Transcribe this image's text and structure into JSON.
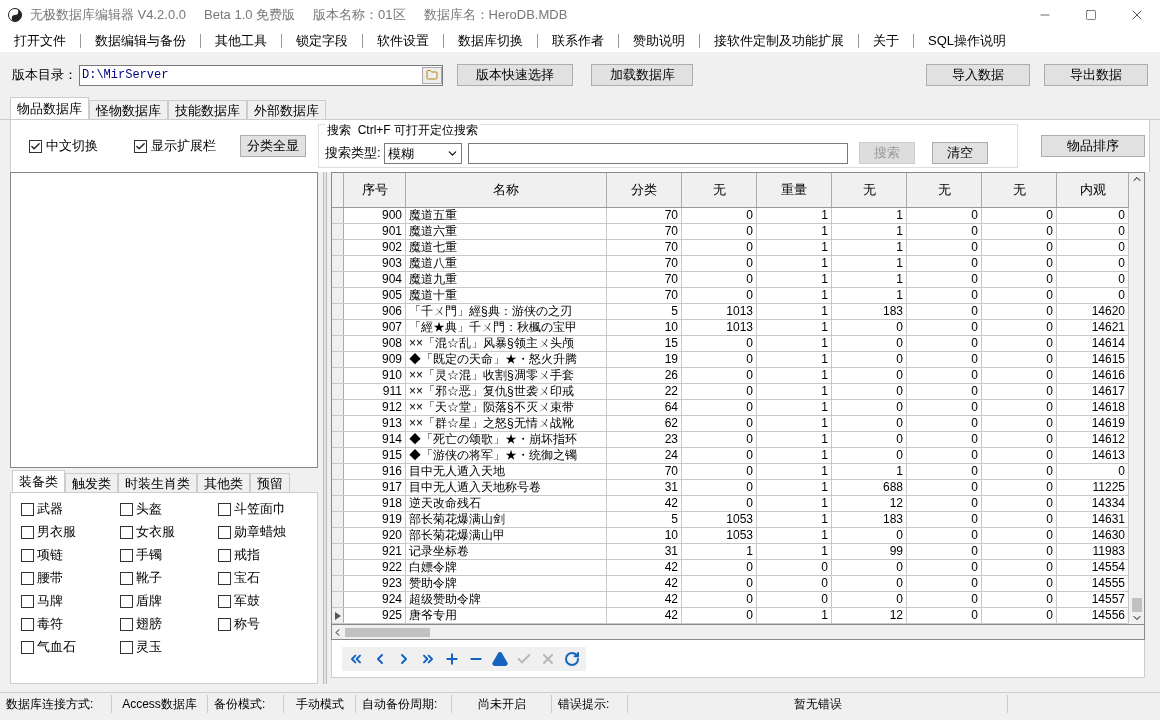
{
  "window": {
    "title_parts": [
      "无极数据库编辑器 V4.2.0.0",
      "Beta 1.0 免费版",
      "版本名称：01区",
      "数据库名：HeroDB.MDB"
    ]
  },
  "menu": [
    "打开文件",
    "数据编辑与备份",
    "其他工具",
    "锁定字段",
    "软件设置",
    "数据库切换",
    "联系作者",
    "赞助说明",
    "接软件定制及功能扩展",
    "关于",
    "SQL操作说明"
  ],
  "toolbar": {
    "path_label": "版本目录：",
    "path_value": "D:\\MirServer",
    "buttons_left": [
      "版本快速选择",
      "加载数据库"
    ],
    "buttons_right": [
      "导入数据",
      "导出数据"
    ]
  },
  "tabs": [
    {
      "label": "物品数据库",
      "selected": true
    },
    {
      "label": "怪物数据库",
      "selected": false
    },
    {
      "label": "技能数据库",
      "selected": false
    },
    {
      "label": "外部数据库",
      "selected": false
    }
  ],
  "options": {
    "checkboxes": [
      {
        "label": "中文切换",
        "checked": true
      },
      {
        "label": "显示扩展栏",
        "checked": true
      }
    ],
    "show_all_button": "分类全显",
    "search_group_title": "搜索  Ctrl+F 可打开定位搜索",
    "search_type_label": "搜索类型:",
    "search_type_value": "模糊",
    "search_button": {
      "label": "搜索",
      "disabled": true
    },
    "clear_button": "清空",
    "sort_button": "物品排序"
  },
  "category_tabs": [
    {
      "label": "装备类",
      "selected": true
    },
    {
      "label": "触发类",
      "selected": false
    },
    {
      "label": "时装生肖类",
      "selected": false
    },
    {
      "label": "其他类",
      "selected": false
    },
    {
      "label": "预留",
      "selected": false
    }
  ],
  "category_items": [
    {
      "label": "武器",
      "checked": false
    },
    {
      "label": "头盔",
      "checked": false
    },
    {
      "label": "斗笠面巾",
      "checked": false
    },
    {
      "label": "男衣服",
      "checked": false
    },
    {
      "label": "女衣服",
      "checked": false
    },
    {
      "label": "勋章蜡烛",
      "checked": false
    },
    {
      "label": "项链",
      "checked": false
    },
    {
      "label": "手镯",
      "checked": false
    },
    {
      "label": "戒指",
      "checked": false
    },
    {
      "label": "腰带",
      "checked": false
    },
    {
      "label": "靴子",
      "checked": false
    },
    {
      "label": "宝石",
      "checked": false
    },
    {
      "label": "马牌",
      "checked": false
    },
    {
      "label": "盾牌",
      "checked": false
    },
    {
      "label": "军鼓",
      "checked": false
    },
    {
      "label": "毒符",
      "checked": false
    },
    {
      "label": "翅膀",
      "checked": false
    },
    {
      "label": "称号",
      "checked": false
    },
    {
      "label": "气血石",
      "checked": false
    },
    {
      "label": "灵玉",
      "checked": false
    }
  ],
  "table": {
    "columns": [
      "序号",
      "名称",
      "分类",
      "无",
      "重量",
      "无",
      "无",
      "无",
      "内观"
    ],
    "rows": [
      {
        "current": false,
        "cells": [
          "900",
          "魔道五重",
          "70",
          "0",
          "1",
          "1",
          "0",
          "0",
          "0"
        ]
      },
      {
        "current": false,
        "cells": [
          "901",
          "魔道六重",
          "70",
          "0",
          "1",
          "1",
          "0",
          "0",
          "0"
        ]
      },
      {
        "current": false,
        "cells": [
          "902",
          "魔道七重",
          "70",
          "0",
          "1",
          "1",
          "0",
          "0",
          "0"
        ]
      },
      {
        "current": false,
        "cells": [
          "903",
          "魔道八重",
          "70",
          "0",
          "1",
          "1",
          "0",
          "0",
          "0"
        ]
      },
      {
        "current": false,
        "cells": [
          "904",
          "魔道九重",
          "70",
          "0",
          "1",
          "1",
          "0",
          "0",
          "0"
        ]
      },
      {
        "current": false,
        "cells": [
          "905",
          "魔道十重",
          "70",
          "0",
          "1",
          "1",
          "0",
          "0",
          "0"
        ]
      },
      {
        "current": false,
        "cells": [
          "906",
          "「千ㄨ門」經§典：游侠の之刃",
          "5",
          "1013",
          "1",
          "183",
          "0",
          "0",
          "14620"
        ]
      },
      {
        "current": false,
        "cells": [
          "907",
          "「經★典」千ㄨ門：秋楓の宝甲",
          "10",
          "1013",
          "1",
          "0",
          "0",
          "0",
          "14621"
        ]
      },
      {
        "current": false,
        "cells": [
          "908",
          "××「混☆乱」风暴§领主ㄨ头颅",
          "15",
          "0",
          "1",
          "0",
          "0",
          "0",
          "14614"
        ]
      },
      {
        "current": false,
        "cells": [
          "909",
          "◆「既定の天命」★・怒火升腾",
          "19",
          "0",
          "1",
          "0",
          "0",
          "0",
          "14615"
        ]
      },
      {
        "current": false,
        "cells": [
          "910",
          "××「灵☆混」收割§凋零ㄨ手套",
          "26",
          "0",
          "1",
          "0",
          "0",
          "0",
          "14616"
        ]
      },
      {
        "current": false,
        "cells": [
          "911",
          "××「邪☆恶」复仇§世袭ㄨ印戒",
          "22",
          "0",
          "1",
          "0",
          "0",
          "0",
          "14617"
        ]
      },
      {
        "current": false,
        "cells": [
          "912",
          "××「天☆堂」陨落§不灭ㄨ束带",
          "64",
          "0",
          "1",
          "0",
          "0",
          "0",
          "14618"
        ]
      },
      {
        "current": false,
        "cells": [
          "913",
          "××「群☆星」之怒§无情ㄨ战靴",
          "62",
          "0",
          "1",
          "0",
          "0",
          "0",
          "14619"
        ]
      },
      {
        "current": false,
        "cells": [
          "914",
          "◆「死亡の颂歌」★・崩坏指环",
          "23",
          "0",
          "1",
          "0",
          "0",
          "0",
          "14612"
        ]
      },
      {
        "current": false,
        "cells": [
          "915",
          "◆「游侠の将军」★・统御之镯",
          "24",
          "0",
          "1",
          "0",
          "0",
          "0",
          "14613"
        ]
      },
      {
        "current": false,
        "cells": [
          "916",
          "目中无人遁入天地",
          "70",
          "0",
          "1",
          "1",
          "0",
          "0",
          "0"
        ]
      },
      {
        "current": false,
        "cells": [
          "917",
          "目中无人遁入天地称号卷",
          "31",
          "0",
          "1",
          "688",
          "0",
          "0",
          "11225"
        ]
      },
      {
        "current": false,
        "cells": [
          "918",
          "逆天改命残石",
          "42",
          "0",
          "1",
          "12",
          "0",
          "0",
          "14334"
        ]
      },
      {
        "current": false,
        "cells": [
          "919",
          "部长菊花爆满山剑",
          "5",
          "1053",
          "1",
          "183",
          "0",
          "0",
          "14631"
        ]
      },
      {
        "current": false,
        "cells": [
          "920",
          "部长菊花爆满山甲",
          "10",
          "1053",
          "1",
          "0",
          "0",
          "0",
          "14630"
        ]
      },
      {
        "current": false,
        "cells": [
          "921",
          "记录坐标卷",
          "31",
          "1",
          "1",
          "99",
          "0",
          "0",
          "11983"
        ]
      },
      {
        "current": false,
        "cells": [
          "922",
          "白嫖令牌",
          "42",
          "0",
          "0",
          "0",
          "0",
          "0",
          "14554"
        ]
      },
      {
        "current": false,
        "cells": [
          "923",
          "赞助令牌",
          "42",
          "0",
          "0",
          "0",
          "0",
          "0",
          "14555"
        ]
      },
      {
        "current": false,
        "cells": [
          "924",
          "超级赞助令牌",
          "42",
          "0",
          "0",
          "0",
          "0",
          "0",
          "14557"
        ]
      },
      {
        "current": true,
        "cells": [
          "925",
          "唐爷专用",
          "42",
          "0",
          "1",
          "12",
          "0",
          "0",
          "14556"
        ]
      }
    ]
  },
  "navigator": [
    {
      "kind": "first",
      "disabled": false
    },
    {
      "kind": "prior",
      "disabled": false
    },
    {
      "kind": "next",
      "disabled": false
    },
    {
      "kind": "last",
      "disabled": false
    },
    {
      "kind": "insert",
      "disabled": false
    },
    {
      "kind": "delete",
      "disabled": false
    },
    {
      "kind": "edit",
      "disabled": false
    },
    {
      "kind": "post",
      "disabled": true
    },
    {
      "kind": "cancel",
      "disabled": true
    },
    {
      "kind": "refresh",
      "disabled": false
    }
  ],
  "status_bar": [
    "数据库连接方式:",
    "Access数据库",
    "备份模式:",
    "手动模式",
    "自动备份周期:",
    "尚未开启",
    "错误提示:",
    "暂无错误"
  ]
}
